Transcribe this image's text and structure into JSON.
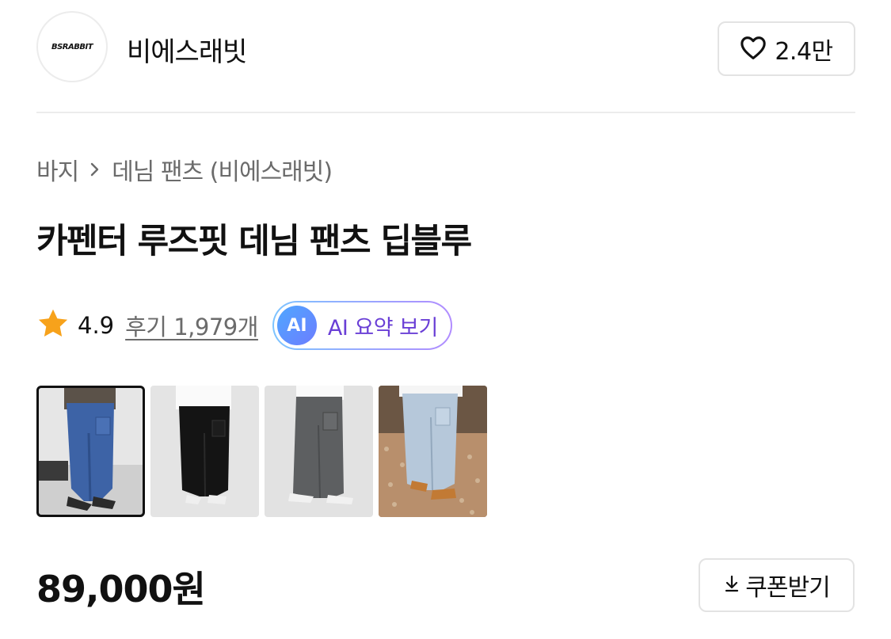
{
  "brand": {
    "logo_text": "BSRABBIT",
    "name": "비에스래빗"
  },
  "like": {
    "icon": "heart-outline-icon",
    "count": "2.4만"
  },
  "breadcrumb": {
    "items": [
      "바지",
      "데님 팬츠 (비에스래빗)"
    ],
    "separator_icon": "chevron-right-icon"
  },
  "product": {
    "title": "카펜터 루즈핏 데님 팬츠 딥블루",
    "price": "89,000원"
  },
  "rating": {
    "icon": "star-icon",
    "value": "4.9",
    "review_link": "후기 1,979개"
  },
  "ai_summary": {
    "badge": "AI",
    "label": "AI 요약 보기"
  },
  "thumbnails": [
    {
      "alt": "deep blue carpenter denim",
      "selected": true
    },
    {
      "alt": "black carpenter pants",
      "selected": false
    },
    {
      "alt": "grey carpenter denim",
      "selected": false
    },
    {
      "alt": "light blue carpenter denim",
      "selected": false
    }
  ],
  "coupon": {
    "icon": "download-arrow-icon",
    "label": "쿠폰받기"
  },
  "colors": {
    "accent_purple": "#6a3fd6",
    "star": "#f7a21b",
    "border": "#e3e3e3",
    "muted_text": "#6b6b6b"
  }
}
